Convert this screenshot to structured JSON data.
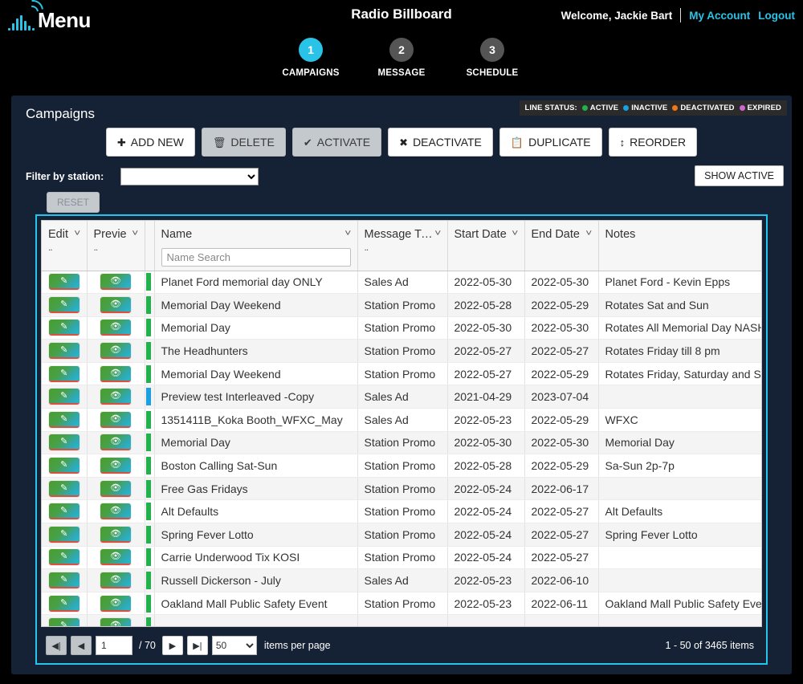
{
  "header": {
    "logo_text": "Menu",
    "logo_icon": "radio-signal-icon",
    "app_title": "Radio Billboard",
    "welcome_text": "Welcome,  Jackie Bart",
    "my_account": "My Account",
    "logout": "Logout",
    "accent_color": "#29c3e8"
  },
  "steps": [
    {
      "num": "1",
      "label": "CAMPAIGNS",
      "active": true
    },
    {
      "num": "2",
      "label": "MESSAGE",
      "active": false
    },
    {
      "num": "3",
      "label": "SCHEDULE",
      "active": false
    }
  ],
  "panel": {
    "title": "Campaigns",
    "legend_title": "LINE STATUS:",
    "legend": [
      {
        "label": "ACTIVE",
        "color": "#22b14c"
      },
      {
        "label": "INACTIVE",
        "color": "#1a9fe0"
      },
      {
        "label": "DEACTIVATED",
        "color": "#f07818"
      },
      {
        "label": "EXPIRED",
        "color": "#d066d0"
      }
    ]
  },
  "toolbar": {
    "add_new": "ADD NEW",
    "add_new_icon": "plus-circle-icon",
    "delete": "DELETE",
    "delete_icon": "trash-icon",
    "activate": "ACTIVATE",
    "activate_icon": "check-circle-icon",
    "deactivate": "DEACTIVATE",
    "deactivate_icon": "x-circle-icon",
    "duplicate": "DUPLICATE",
    "duplicate_icon": "copy-icon",
    "reorder": "REORDER",
    "reorder_icon": "updown-arrows-icon"
  },
  "filters": {
    "station_label": "Filter by station:",
    "station_value": "",
    "show_active": "SHOW ACTIVE",
    "reset": "RESET"
  },
  "table": {
    "columns": [
      {
        "label": "Edit",
        "truncated": "Edit"
      },
      {
        "label": "Preview",
        "truncated": "Previe"
      },
      {
        "label": "Name"
      },
      {
        "label": "Message Type",
        "truncated": "Message Type"
      },
      {
        "label": "Start Date"
      },
      {
        "label": "End Date"
      },
      {
        "label": "Notes"
      }
    ],
    "name_search_placeholder": "Name Search",
    "edit_icon": "pencil-square-icon",
    "preview_icon": "eye-icon",
    "rows": [
      {
        "status": "#22b14c",
        "name": "Planet Ford memorial day ONLY",
        "type": "Sales Ad",
        "start": "2022-05-30",
        "end": "2022-05-30",
        "notes": "Planet Ford - Kevin Epps"
      },
      {
        "status": "#22b14c",
        "name": "Memorial Day Weekend",
        "type": "Station Promo",
        "start": "2022-05-28",
        "end": "2022-05-29",
        "notes": "Rotates Sat and Sun"
      },
      {
        "status": "#22b14c",
        "name": "Memorial Day",
        "type": "Station Promo",
        "start": "2022-05-30",
        "end": "2022-05-30",
        "notes": "Rotates All Memorial Day NASH"
      },
      {
        "status": "#22b14c",
        "name": "The Headhunters",
        "type": "Station Promo",
        "start": "2022-05-27",
        "end": "2022-05-27",
        "notes": "Rotates Friday till 8 pm"
      },
      {
        "status": "#22b14c",
        "name": "Memorial Day Weekend",
        "type": "Station Promo",
        "start": "2022-05-27",
        "end": "2022-05-29",
        "notes": "Rotates Friday, Saturday and Sunday"
      },
      {
        "status": "#1a9fe0",
        "name": "Preview test Interleaved -Copy",
        "type": "Sales Ad",
        "start": "2021-04-29",
        "end": "2023-07-04",
        "notes": ""
      },
      {
        "status": "#22b14c",
        "name": "1351411B_Koka Booth_WFXC_May",
        "type": "Sales Ad",
        "start": "2022-05-23",
        "end": "2022-05-29",
        "notes": "WFXC"
      },
      {
        "status": "#22b14c",
        "name": "Memorial Day",
        "type": "Station Promo",
        "start": "2022-05-30",
        "end": "2022-05-30",
        "notes": "Memorial Day"
      },
      {
        "status": "#22b14c",
        "name": "Boston Calling Sat-Sun",
        "type": "Station Promo",
        "start": "2022-05-28",
        "end": "2022-05-29",
        "notes": "Sa-Sun 2p-7p"
      },
      {
        "status": "#22b14c",
        "name": "Free Gas Fridays",
        "type": "Station Promo",
        "start": "2022-05-24",
        "end": "2022-06-17",
        "notes": ""
      },
      {
        "status": "#22b14c",
        "name": "Alt Defaults",
        "type": "Station Promo",
        "start": "2022-05-24",
        "end": "2022-05-27",
        "notes": "Alt Defaults"
      },
      {
        "status": "#22b14c",
        "name": "Spring Fever Lotto",
        "type": "Station Promo",
        "start": "2022-05-24",
        "end": "2022-05-27",
        "notes": "Spring Fever Lotto"
      },
      {
        "status": "#22b14c",
        "name": "Carrie Underwood Tix KOSI",
        "type": "Station Promo",
        "start": "2022-05-24",
        "end": "2022-05-27",
        "notes": ""
      },
      {
        "status": "#22b14c",
        "name": "Russell Dickerson - July",
        "type": "Sales Ad",
        "start": "2022-05-23",
        "end": "2022-06-10",
        "notes": ""
      },
      {
        "status": "#22b14c",
        "name": "Oakland Mall Public Safety Event",
        "type": "Station Promo",
        "start": "2022-05-23",
        "end": "2022-06-11",
        "notes": "Oakland Mall Public Safety Event"
      },
      {
        "status": "#22b14c",
        "name": "",
        "type": "",
        "start": "",
        "end": "",
        "notes": ""
      }
    ]
  },
  "pager": {
    "first_icon": "first-page-icon",
    "prev_icon": "prev-page-icon",
    "next_icon": "next-page-icon",
    "last_icon": "last-page-icon",
    "page_value": "1",
    "page_total": "/ 70",
    "page_size": "50",
    "items_per_page": "items per page",
    "range_text": "1 - 50 of 3465 items"
  }
}
